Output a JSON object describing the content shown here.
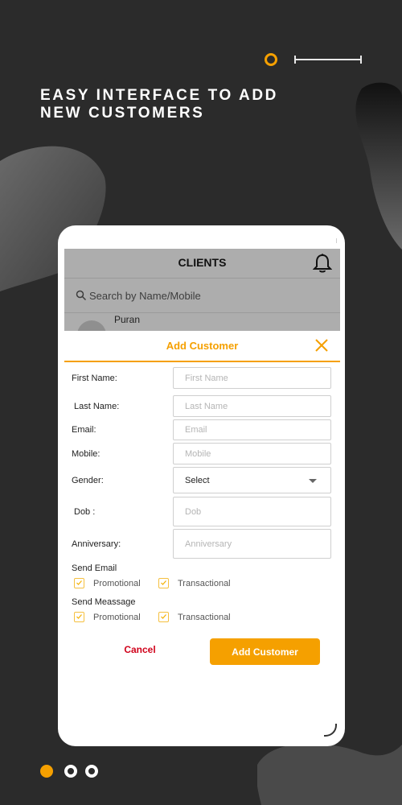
{
  "headline": {
    "line1": "EASY INTERFACE TO ADD",
    "line2": "NEW CUSTOMERS"
  },
  "colors": {
    "accent": "#f5a000",
    "background": "#2b2b2b",
    "cancel": "#d0021b",
    "overlay": "#adadad"
  },
  "app": {
    "title": "CLIENTS",
    "search_placeholder": "Search by Name/Mobile",
    "list": [
      {
        "name": "Puran"
      }
    ]
  },
  "modal": {
    "title": "Add Customer",
    "fields": {
      "first_name": {
        "label": "First Name:",
        "placeholder": "First Name"
      },
      "last_name": {
        "label": "Last Name:",
        "placeholder": "Last Name"
      },
      "email": {
        "label": "Email:",
        "placeholder": "Email"
      },
      "mobile": {
        "label": "Mobile:",
        "placeholder": "Mobile"
      },
      "gender": {
        "label": "Gender:",
        "value": "Select"
      },
      "dob": {
        "label": "Dob :",
        "placeholder": "Dob"
      },
      "anniversary": {
        "label": "Anniversary:",
        "placeholder": "Anniversary"
      }
    },
    "send_email": {
      "label": "Send Email",
      "options": [
        "Promotional",
        "Transactional"
      ]
    },
    "send_message": {
      "label": "Send Meassage",
      "options": [
        "Promotional",
        "Transactional"
      ]
    },
    "cancel_label": "Cancel",
    "submit_label": "Add Customer"
  },
  "pagination": {
    "current": 1,
    "total": 3
  },
  "icons": [
    "bell-icon",
    "search-icon",
    "close-icon",
    "chevron-down-icon",
    "check-icon"
  ]
}
